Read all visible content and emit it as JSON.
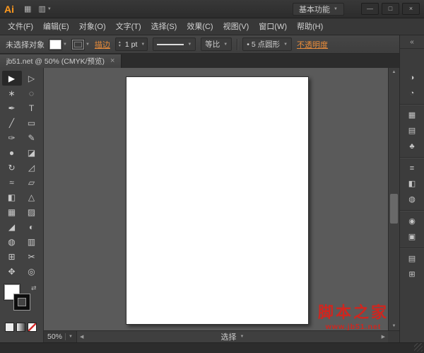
{
  "icons": {
    "caret_down": "▼",
    "caret_up": "▲",
    "caret_left": "◀",
    "caret_right": "▶",
    "dock_collapse": "«",
    "close": "×",
    "minimize": "—",
    "maximize": "□",
    "bridge": "▦",
    "arrange": "▥",
    "swap": "⇄"
  },
  "titlebar": {
    "logo": "Ai",
    "workspace": "基本功能"
  },
  "menubar": {
    "items": [
      "文件(F)",
      "编辑(E)",
      "对象(O)",
      "文字(T)",
      "选择(S)",
      "效果(C)",
      "视图(V)",
      "窗口(W)",
      "帮助(H)"
    ]
  },
  "controlbar": {
    "selection_status": "未选择对象",
    "stroke_link": "描边",
    "stroke_width": "1 pt",
    "profile": "等比",
    "brush": "• 5 点圆形",
    "opacity_link": "不透明度"
  },
  "tabbar": {
    "tab_title": "jb51.net @ 50% (CMYK/预览)"
  },
  "toolbar": {
    "tools": [
      {
        "name": "selection-tool",
        "glyph": "▶",
        "active": true
      },
      {
        "name": "direct-selection-tool",
        "glyph": "▷"
      },
      {
        "name": "magic-wand-tool",
        "glyph": "∗"
      },
      {
        "name": "lasso-tool",
        "glyph": "◌"
      },
      {
        "name": "pen-tool",
        "glyph": "✒"
      },
      {
        "name": "type-tool",
        "glyph": "T"
      },
      {
        "name": "line-segment-tool",
        "glyph": "╱"
      },
      {
        "name": "rectangle-tool",
        "glyph": "▭"
      },
      {
        "name": "paintbrush-tool",
        "glyph": "✑"
      },
      {
        "name": "pencil-tool",
        "glyph": "✎"
      },
      {
        "name": "blob-brush-tool",
        "glyph": "●"
      },
      {
        "name": "eraser-tool",
        "glyph": "◪"
      },
      {
        "name": "rotate-tool",
        "glyph": "↻"
      },
      {
        "name": "scale-tool",
        "glyph": "◿"
      },
      {
        "name": "width-tool",
        "glyph": "≈"
      },
      {
        "name": "free-transform-tool",
        "glyph": "▱"
      },
      {
        "name": "shape-builder-tool",
        "glyph": "◧"
      },
      {
        "name": "perspective-grid-tool",
        "glyph": "△"
      },
      {
        "name": "mesh-tool",
        "glyph": "▦"
      },
      {
        "name": "gradient-tool",
        "glyph": "▨"
      },
      {
        "name": "eyedropper-tool",
        "glyph": "◢"
      },
      {
        "name": "blend-tool",
        "glyph": "◐"
      },
      {
        "name": "symbol-sprayer-tool",
        "glyph": "◍"
      },
      {
        "name": "column-graph-tool",
        "glyph": "▥"
      },
      {
        "name": "artboard-tool",
        "glyph": "⊞"
      },
      {
        "name": "slice-tool",
        "glyph": "✂"
      },
      {
        "name": "hand-tool",
        "glyph": "✥"
      },
      {
        "name": "zoom-tool",
        "glyph": "◎"
      }
    ]
  },
  "dock": {
    "groups": [
      {
        "items": [
          {
            "name": "color-panel-icon",
            "glyph": "◑"
          },
          {
            "name": "color-guide-panel-icon",
            "glyph": "◔"
          }
        ]
      },
      {
        "items": [
          {
            "name": "swatches-panel-icon",
            "glyph": "▦"
          },
          {
            "name": "brushes-panel-icon",
            "glyph": "▤"
          },
          {
            "name": "symbols-panel-icon",
            "glyph": "♣"
          }
        ]
      },
      {
        "items": [
          {
            "name": "stroke-panel-icon",
            "glyph": "≡"
          },
          {
            "name": "gradient-panel-icon",
            "glyph": "◧"
          },
          {
            "name": "transparency-panel-icon",
            "glyph": "◍"
          }
        ]
      },
      {
        "items": [
          {
            "name": "appearance-panel-icon",
            "glyph": "◉"
          },
          {
            "name": "graphic-styles-panel-icon",
            "glyph": "▣"
          }
        ]
      },
      {
        "items": [
          {
            "name": "layers-panel-icon",
            "glyph": "▤"
          },
          {
            "name": "artboards-panel-icon",
            "glyph": "⊞"
          }
        ]
      }
    ]
  },
  "statusbar": {
    "zoom": "50%",
    "status": "选择"
  },
  "watermark": {
    "title": "脚本之家",
    "url": "www.jb51.net"
  },
  "colors": {
    "accent_orange": "#e98c3a",
    "logo_orange": "#ff9a1e",
    "watermark_red": "#cf261f",
    "canvas_gray": "#5a5a5a",
    "panel_gray": "#424242"
  }
}
